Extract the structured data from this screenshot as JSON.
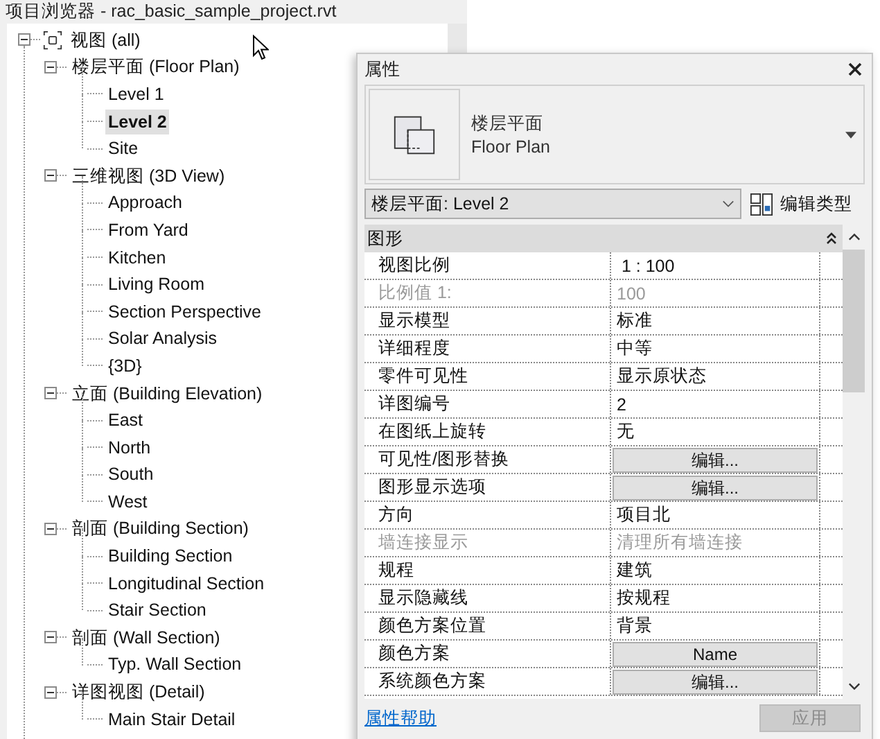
{
  "browser": {
    "title": "项目浏览器 - rac_basic_sample_project.rvt",
    "tree": {
      "label": "视图 (all)",
      "expanded": true,
      "children": [
        {
          "label": "楼层平面 (Floor Plan)",
          "expanded": true,
          "children": [
            {
              "label": "Level 1",
              "selected": false
            },
            {
              "label": "Level 2",
              "selected": true
            },
            {
              "label": "Site",
              "selected": false
            }
          ]
        },
        {
          "label": "三维视图 (3D View)",
          "expanded": true,
          "children": [
            {
              "label": "Approach",
              "selected": false
            },
            {
              "label": "From Yard",
              "selected": false
            },
            {
              "label": "Kitchen",
              "selected": false
            },
            {
              "label": "Living Room",
              "selected": false
            },
            {
              "label": "Section Perspective",
              "selected": false
            },
            {
              "label": "Solar Analysis",
              "selected": false
            },
            {
              "label": "{3D}",
              "selected": false
            }
          ]
        },
        {
          "label": "立面 (Building Elevation)",
          "expanded": true,
          "children": [
            {
              "label": "East",
              "selected": false
            },
            {
              "label": "North",
              "selected": false
            },
            {
              "label": "South",
              "selected": false
            },
            {
              "label": "West",
              "selected": false
            }
          ]
        },
        {
          "label": "剖面 (Building Section)",
          "expanded": true,
          "children": [
            {
              "label": "Building Section",
              "selected": false
            },
            {
              "label": "Longitudinal Section",
              "selected": false
            },
            {
              "label": "Stair Section",
              "selected": false
            }
          ]
        },
        {
          "label": "剖面 (Wall Section)",
          "expanded": true,
          "children": [
            {
              "label": "Typ. Wall Section",
              "selected": false
            }
          ]
        },
        {
          "label": "详图视图 (Detail)",
          "expanded": true,
          "children": [
            {
              "label": "Main Stair Detail",
              "selected": false
            }
          ]
        }
      ]
    }
  },
  "properties": {
    "title": "属性",
    "type_name": "楼层平面",
    "type_name_en": "Floor Plan",
    "instance_selector": "楼层平面: Level 2",
    "edit_type": "编辑类型",
    "group": {
      "label": "图形",
      "expanded": true
    },
    "rows": [
      {
        "label": "视图比例",
        "value": " 1 : 100",
        "kind": "text",
        "disabled": false
      },
      {
        "label": "比例值 1:",
        "value": "100",
        "kind": "text",
        "disabled": true
      },
      {
        "label": "显示模型",
        "value": "标准",
        "kind": "text",
        "disabled": false
      },
      {
        "label": "详细程度",
        "value": "中等",
        "kind": "text",
        "disabled": false
      },
      {
        "label": "零件可见性",
        "value": "显示原状态",
        "kind": "text",
        "disabled": false
      },
      {
        "label": "详图编号",
        "value": "2",
        "kind": "text",
        "disabled": false
      },
      {
        "label": "在图纸上旋转",
        "value": "无",
        "kind": "text",
        "disabled": false
      },
      {
        "label": "可见性/图形替换",
        "value": "编辑...",
        "kind": "button",
        "disabled": false
      },
      {
        "label": "图形显示选项",
        "value": "编辑...",
        "kind": "button",
        "disabled": false
      },
      {
        "label": "方向",
        "value": "项目北",
        "kind": "text",
        "disabled": false
      },
      {
        "label": "墙连接显示",
        "value": "清理所有墙连接",
        "kind": "text",
        "disabled": true
      },
      {
        "label": "规程",
        "value": "建筑",
        "kind": "text",
        "disabled": false
      },
      {
        "label": "显示隐藏线",
        "value": "按规程",
        "kind": "text",
        "disabled": false
      },
      {
        "label": "颜色方案位置",
        "value": "背景",
        "kind": "text",
        "disabled": false
      },
      {
        "label": "颜色方案",
        "value": "Name",
        "kind": "button",
        "disabled": false
      },
      {
        "label": "系统颜色方案",
        "value": "编辑...",
        "kind": "button",
        "disabled": false
      }
    ],
    "help_link": "属性帮助",
    "apply": {
      "label": "应用",
      "disabled": true
    }
  }
}
